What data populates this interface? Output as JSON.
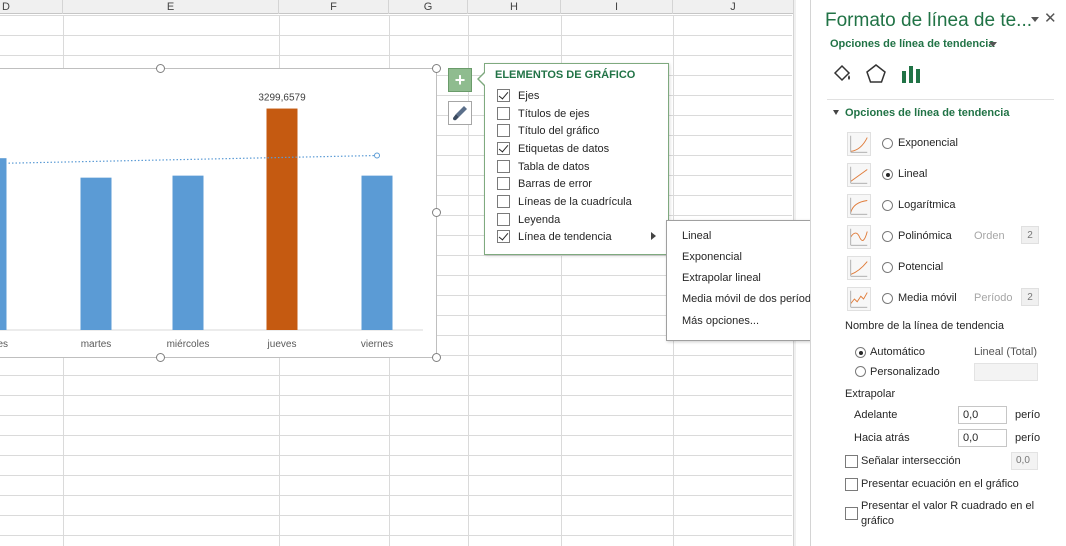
{
  "columns": [
    "D",
    "E",
    "F",
    "G",
    "H",
    "I",
    "J"
  ],
  "chart_data": {
    "type": "bar",
    "categories": [
      "es",
      "martes",
      "miércoles",
      "jueves",
      "viernes"
    ],
    "values": [
      2560,
      2270,
      2300,
      3299.6579,
      2300
    ],
    "highlight_index": 3,
    "data_label": "3299,6579",
    "series_color": "#5b9bd5",
    "highlight_color": "#c55a11",
    "trendline": {
      "type": "linear",
      "color": "#5b9bd5",
      "from": 2480,
      "to": 2600
    },
    "ylim": [
      0,
      3500
    ],
    "grid": false
  },
  "chart_elements_popup": {
    "title": "ELEMENTOS DE GRÁFICO",
    "items": [
      {
        "label": "Ejes",
        "checked": true
      },
      {
        "label": "Títulos de ejes",
        "checked": false
      },
      {
        "label": "Título del gráfico",
        "checked": false
      },
      {
        "label": "Etiquetas de datos",
        "checked": true
      },
      {
        "label": "Tabla de datos",
        "checked": false
      },
      {
        "label": "Barras de error",
        "checked": false
      },
      {
        "label": "Líneas de la cuadrícula",
        "checked": false
      },
      {
        "label": "Leyenda",
        "checked": false
      },
      {
        "label": "Línea de tendencia",
        "checked": true,
        "has_submenu": true
      }
    ]
  },
  "trendline_submenu": {
    "items": [
      "Lineal",
      "Exponencial",
      "Extrapolar lineal",
      "Media móvil de dos períodos",
      "Más opciones..."
    ]
  },
  "pane": {
    "title": "Formato de línea de te...",
    "subtitle": "Opciones de línea de tendencia",
    "section_title": "Opciones de línea de tendencia",
    "tabs": [
      "fill-line-icon",
      "effects-icon",
      "trendline-options-icon"
    ],
    "trend_types": [
      {
        "label": "Exponencial",
        "selected": false
      },
      {
        "label": "Lineal",
        "selected": true
      },
      {
        "label": "Logarítmica",
        "selected": false
      },
      {
        "label": "Polinómica",
        "selected": false,
        "extra_label": "Orden",
        "extra_value": "2"
      },
      {
        "label": "Potencial",
        "selected": false
      },
      {
        "label": "Media móvil",
        "selected": false,
        "extra_label": "Período",
        "extra_value": "2"
      }
    ],
    "name_section": "Nombre de la línea de tendencia",
    "auto_label": "Automático",
    "auto_value": "Lineal (Total)",
    "custom_label": "Personalizado",
    "custom_value": "",
    "extrapolate_title": "Extrapolar",
    "forward_label": "Adelante",
    "forward_value": "0,0",
    "backward_label": "Hacia atrás",
    "backward_value": "0,0",
    "periods_unit": "perío",
    "intercept_label": "Señalar intersección",
    "intercept_value": "0,0",
    "show_equation_label": "Presentar ecuación en el gráfico",
    "show_r2_label_1": "Presentar el valor R cuadrado en el",
    "show_r2_label_2": "gráfico"
  }
}
